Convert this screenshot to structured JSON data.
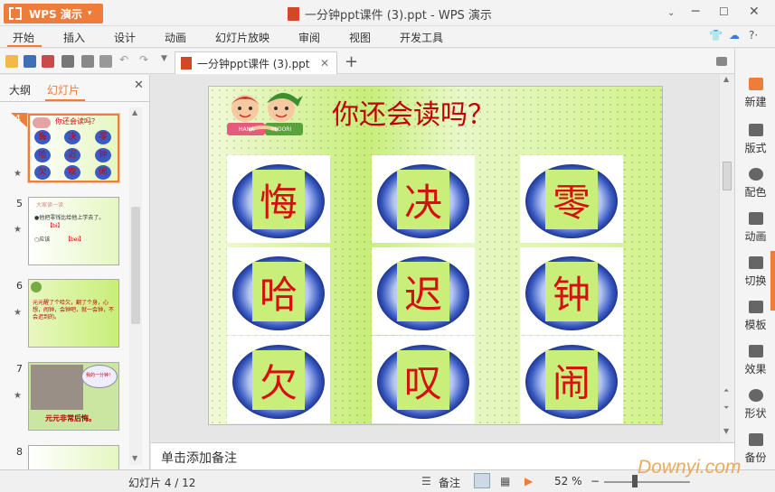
{
  "app": {
    "menu_label": "WPS 演示",
    "title": "一分钟ppt课件 (3).ppt - WPS 演示"
  },
  "menu": [
    "开始",
    "插入",
    "设计",
    "动画",
    "幻灯片放映",
    "审阅",
    "视图",
    "开发工具"
  ],
  "tab": {
    "label": "一分钟ppt课件 (3).ppt"
  },
  "left_panel": {
    "tabs": [
      "大纲",
      "幻灯片"
    ],
    "active_tab": "幻灯片"
  },
  "thumbnails": [
    {
      "num": "4",
      "title": "你还会读吗？",
      "chars": [
        "悔",
        "决",
        "零",
        "哈",
        "迟",
        "钟",
        "欠",
        "叹",
        "闹"
      ]
    },
    {
      "num": "5",
      "line0": "大家读一读",
      "line1": "●他把零钱比给他上学去了。",
      "line1b": "【bi】",
      "line2": "○应该",
      "line2b": "【bei】"
    },
    {
      "num": "6",
      "text": "元元醒了个哈欠，翻了个身，心想，闹钟，会钟吧，就一会钟，不会迟到的。"
    },
    {
      "num": "7",
      "caption": "元元非常后悔。",
      "bubble": "我的一分钟！"
    },
    {
      "num": "8"
    }
  ],
  "slide": {
    "title": "你还会读吗？",
    "kid_labels": [
      "HANA",
      "MIDORI"
    ],
    "chars": [
      "悔",
      "决",
      "零",
      "哈",
      "迟",
      "钟",
      "欠",
      "叹",
      "闹"
    ]
  },
  "notes_placeholder": "单击添加备注",
  "right_panel": [
    "新建",
    "版式",
    "配色",
    "动画",
    "切换",
    "模板",
    "效果",
    "形状",
    "备份"
  ],
  "status": {
    "slide_info": "幻灯片 4 / 12",
    "notes_label": "备注",
    "zoom": "52 %"
  },
  "watermark": "Downyi.com",
  "colors": {
    "accent": "#ee7c3a",
    "slide_char": "#d41010"
  }
}
